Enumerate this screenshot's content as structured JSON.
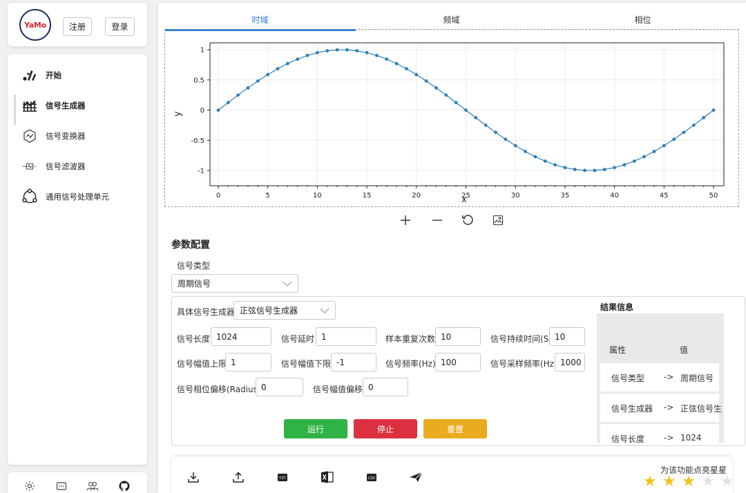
{
  "header": {
    "logo_text": "YaMo",
    "register_label": "注册",
    "login_label": "登录"
  },
  "sidebar": {
    "items": [
      {
        "label": "开始",
        "icon": "start-icon"
      },
      {
        "label": "信号生成器",
        "icon": "grid-chart-icon"
      },
      {
        "label": "信号变换器",
        "icon": "transform-icon"
      },
      {
        "label": "信号滤波器",
        "icon": "filter-icon"
      },
      {
        "label": "通用信号处理单元",
        "icon": "network-icon"
      }
    ],
    "active_index": 1,
    "bottom_icons": [
      "settings-icon",
      "chat-icon",
      "users-icon",
      "github-icon"
    ]
  },
  "tabs": [
    "时域",
    "频域",
    "相位"
  ],
  "active_tab": 0,
  "plot_tools": [
    "zoom-in-icon",
    "zoom-out-icon",
    "reset-icon",
    "save-image-icon"
  ],
  "chart_data": {
    "type": "line",
    "xlabel": "x",
    "ylabel": "y",
    "xlim": [
      0,
      50
    ],
    "ylim": [
      -1,
      1
    ],
    "xticks": [
      0,
      5,
      10,
      15,
      20,
      25,
      30,
      35,
      40,
      45,
      50
    ],
    "yticks": [
      1,
      0.5,
      0,
      -0.5,
      -1
    ],
    "grid": true,
    "series": [
      {
        "color": "#2e7fb8",
        "x": [
          0,
          1,
          2,
          3,
          4,
          5,
          6,
          7,
          8,
          9,
          10,
          11,
          12,
          13,
          14,
          15,
          16,
          17,
          18,
          19,
          20,
          21,
          22,
          23,
          24,
          25,
          26,
          27,
          28,
          29,
          30,
          31,
          32,
          33,
          34,
          35,
          36,
          37,
          38,
          39,
          40,
          41,
          42,
          43,
          44,
          45,
          46,
          47,
          48,
          49,
          50
        ],
        "y": [
          0,
          0.125,
          0.249,
          0.368,
          0.482,
          0.588,
          0.685,
          0.771,
          0.844,
          0.905,
          0.951,
          0.982,
          0.998,
          0.998,
          0.982,
          0.951,
          0.905,
          0.844,
          0.771,
          0.685,
          0.588,
          0.482,
          0.368,
          0.249,
          0.125,
          0,
          -0.125,
          -0.249,
          -0.368,
          -0.482,
          -0.588,
          -0.685,
          -0.771,
          -0.844,
          -0.905,
          -0.951,
          -0.982,
          -0.998,
          -0.998,
          -0.982,
          -0.951,
          -0.905,
          -0.844,
          -0.771,
          -0.685,
          -0.588,
          -0.482,
          -0.368,
          -0.249,
          -0.125,
          0
        ]
      }
    ]
  },
  "config": {
    "title": "参数配置",
    "signal_type_label": "信号类型",
    "signal_type_value": "周期信号",
    "generator_label": "具体信号生成器",
    "generator_value": "正弦信号生成器",
    "fields": [
      {
        "label": "信号长度",
        "value": "1024"
      },
      {
        "label": "信号延时",
        "value": "1"
      },
      {
        "label": "样本重复次数",
        "value": "10"
      },
      {
        "label": "信号持续时间(S)",
        "value": "10"
      },
      {
        "label": "信号幅值上限",
        "value": "1"
      },
      {
        "label": "信号幅值下限",
        "value": "-1"
      },
      {
        "label": "信号频率(Hz)",
        "value": "100"
      },
      {
        "label": "信号采样频率(Hz)",
        "value": "1000"
      },
      {
        "label": "信号相位偏移(Radius)",
        "value": "0"
      },
      {
        "label": "信号幅值偏移",
        "value": "0"
      }
    ],
    "buttons": {
      "run": "运行",
      "stop": "停止",
      "reset": "重置"
    },
    "colors": {
      "run": "#2fb344",
      "stop": "#dc2f3f",
      "reset": "#e8ac1e"
    }
  },
  "results": {
    "title": "结果信息",
    "col_attr": "属性",
    "col_value": "值",
    "rows": [
      {
        "attr": "信号类型",
        "arrow": "->",
        "value": "周期信号"
      },
      {
        "attr": "信号生成器",
        "arrow": "->",
        "value": "正弦信号生"
      },
      {
        "attr": "信号长度",
        "arrow": "->",
        "value": "1024"
      }
    ]
  },
  "bottom_bar": {
    "icons": [
      "download-icon",
      "upload-icon",
      "txt-file-icon",
      "excel-file-icon",
      "csv-file-icon",
      "send-icon"
    ],
    "rate_text": "为该功能点亮星星",
    "rating": 3,
    "max_rating": 5
  }
}
